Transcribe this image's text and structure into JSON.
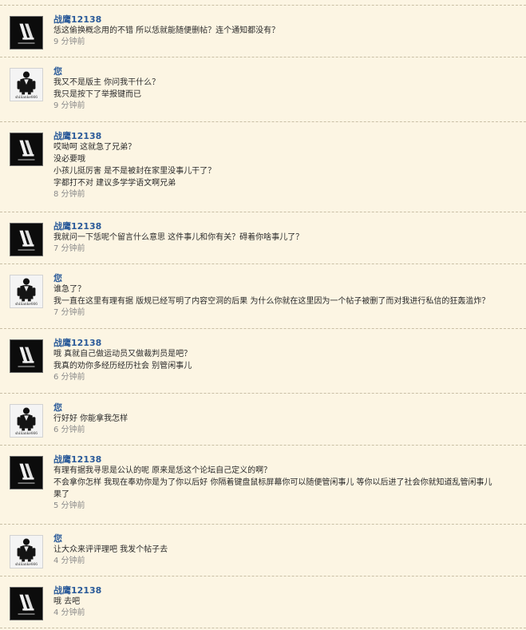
{
  "thread": {
    "messages": [
      {
        "author": "战鹰12138",
        "is_self": false,
        "lines": [
          "恁这偷换概念用的不错 所以恁就能随便删帖？连个通知都没有？"
        ],
        "time": "9 分钟前"
      },
      {
        "author": "您",
        "is_self": true,
        "lines": [
          "我又不是版主 你问我干什么？",
          "我只是按下了举报键而已"
        ],
        "time": "9 分钟前"
      },
      {
        "author": "战鹰12138",
        "is_self": false,
        "lines": [
          "哎呦呵 这就急了兄弟？",
          "没必要哦",
          "小孩儿挺厉害 是不是被封在家里没事儿干了？",
          "字都打不对 建议多学学语文啊兄弟"
        ],
        "time": "8 分钟前"
      },
      {
        "author": "战鹰12138",
        "is_self": false,
        "lines": [
          "我就问一下恁呢个留言什么意思 这件事儿和你有关？碍着你啥事儿了？"
        ],
        "time": "7 分钟前"
      },
      {
        "author": "您",
        "is_self": true,
        "lines": [
          "谁急了？",
          "我一直在这里有理有据 版规已经写明了内容空洞的后果 为什么你就在这里因为一个帖子被删了而对我进行私信的狂轰滥炸？"
        ],
        "time": "7 分钟前"
      },
      {
        "author": "战鹰12138",
        "is_self": false,
        "lines": [
          "哦 真就自己做运动员又做裁判员是吧？",
          "我真的劝你多经历经历社会 别管闲事儿"
        ],
        "time": "6 分钟前"
      },
      {
        "author": "您",
        "is_self": true,
        "lines": [
          "行好好 你能拿我怎样"
        ],
        "time": "6 分钟前"
      },
      {
        "author": "战鹰12138",
        "is_self": false,
        "lines": [
          "有理有据我寻思是公认的呢 原来是恁这个论坛自己定义的啊？",
          "不会拿你怎样 我现在奉劝你是为了你以后好 你隔着键盘鼠标屏幕你可以随便管闲事儿 等你以后进了社会你就知道乱管闲事儿",
          "果了"
        ],
        "time": "5 分钟前"
      },
      {
        "author": "您",
        "is_self": true,
        "lines": [
          "让大众来评评理吧 我发个帖子去"
        ],
        "time": "4 分钟前"
      },
      {
        "author": "战鹰12138",
        "is_self": false,
        "lines": [
          "哦 去吧"
        ],
        "time": "4 分钟前"
      }
    ]
  },
  "avatars": {
    "peer": {
      "icon": "lv-logo-avatar-icon",
      "bg": "#0c0c0c",
      "fg": "#f2f2f2"
    },
    "self": {
      "icon": "suit-figure-avatar-icon",
      "caption": "shiiianke666",
      "bg": "#f4f4f4",
      "fg": "#111111"
    }
  },
  "colors": {
    "background": "#fcf5e3",
    "author": "#2a5a99",
    "text": "#2a2a2a",
    "time": "#8a8a8a",
    "separator": "#c9bfa5"
  }
}
